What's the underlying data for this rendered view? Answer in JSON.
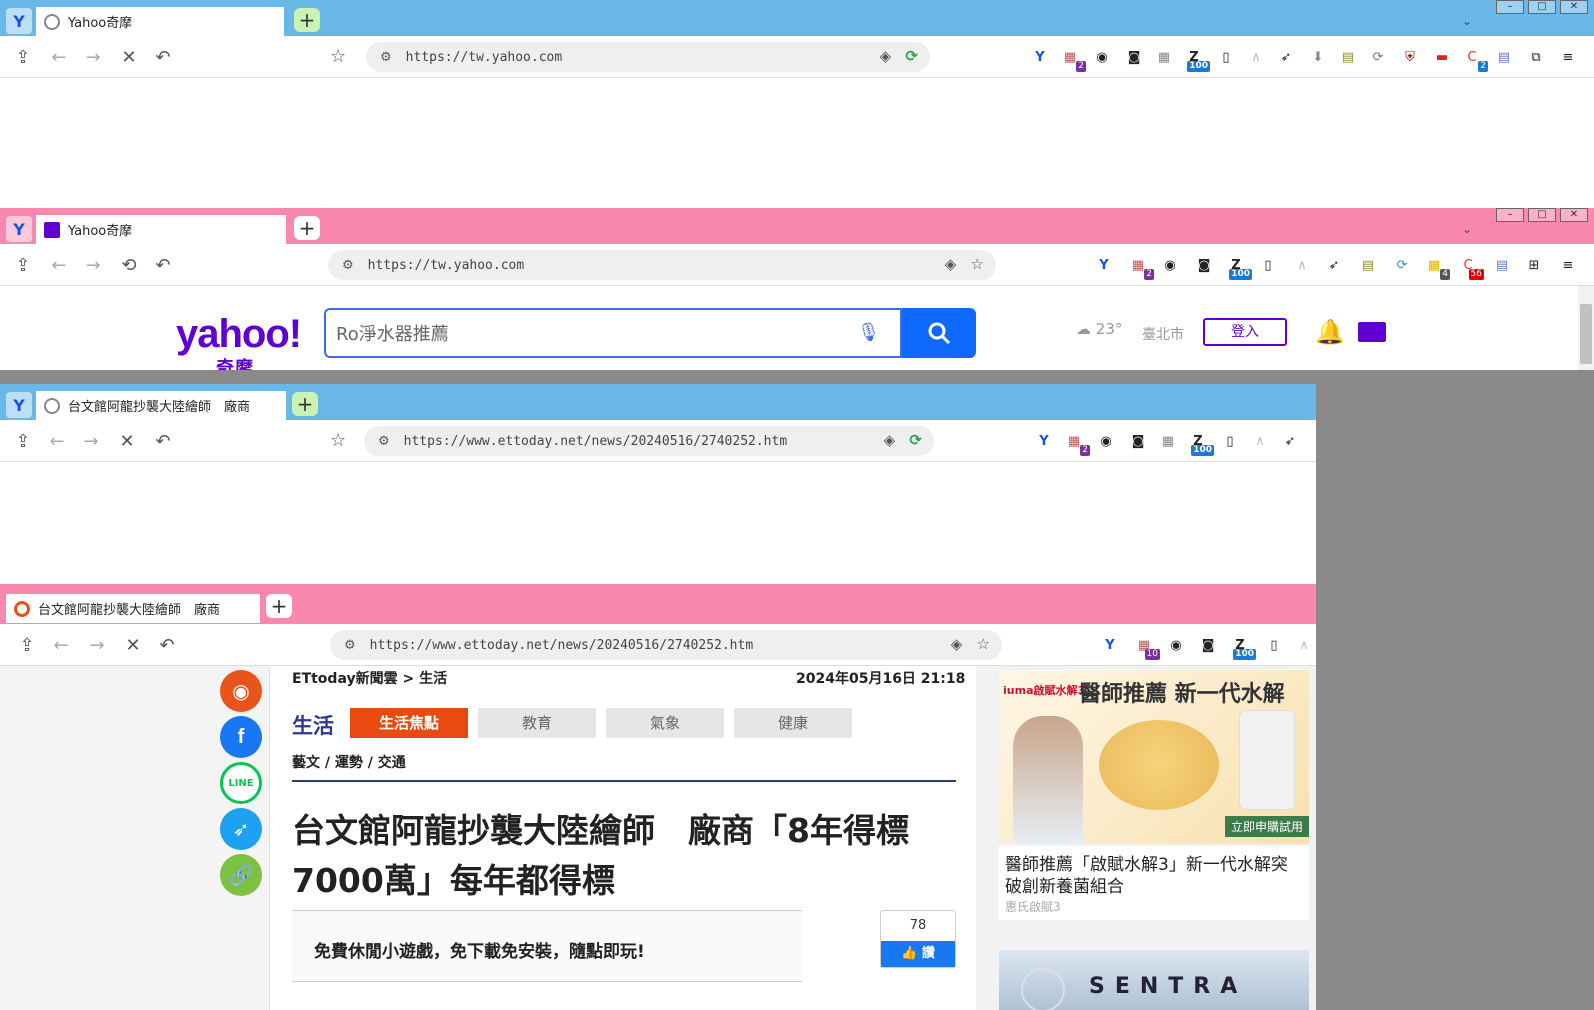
{
  "windows": [
    {
      "tab_title": "Yahoo奇摩",
      "url": "https://tw.yahoo.com",
      "theme": "#6ab8e8"
    },
    {
      "tab_title": "Yahoo奇摩",
      "url": "https://tw.yahoo.com",
      "theme": "#f888b0"
    },
    {
      "tab_title": "台文館阿龍抄襲大陸繪師　廠商",
      "url": "https://www.ettoday.net/news/20240516/2740252.htm",
      "theme": "#6ab8e8"
    },
    {
      "tab_title": "台文館阿龍抄襲大陸繪師　廠商",
      "url": "https://www.ettoday.net/news/20240516/2740252.htm",
      "theme": "#f888b0"
    }
  ],
  "yahoo": {
    "logo": "yahoo!",
    "logo_sub": "奇摩",
    "search_value": "Ro淨水器推薦",
    "temperature": "23°",
    "city": "臺北市",
    "login_label": "登入"
  },
  "extension_badges": {
    "translate": "2",
    "zoom": "100",
    "ext4": "4",
    "ext56": "56",
    "ext10": "10"
  },
  "article": {
    "breadcrumb": "ETtoday新聞雲 > 生活",
    "date": "2024年05月16日 21:18",
    "section": "生活",
    "categories": [
      "生活焦點",
      "教育",
      "氣象",
      "健康"
    ],
    "subcategories": "藝文 / 運勢 / 交通",
    "headline": "台文館阿龍抄襲大陸繪師　廠商「8年得標7000萬」每年都得標",
    "promo": "免費休閒小遊戲，免下載免安裝，隨點即玩!",
    "like_count": "78",
    "like_label": "讚"
  },
  "sidebar_ad": {
    "brand": "iuma啟賦水解3",
    "title": "醫師推薦 新一代水解",
    "cta": "立即申購試用",
    "caption": "醫師推薦「啟賦水解3」新一代水解突破創新養菌組合",
    "sponsor": "惠氏啟賦3"
  },
  "sidebar_ad2": {
    "title": "SENTRA"
  }
}
